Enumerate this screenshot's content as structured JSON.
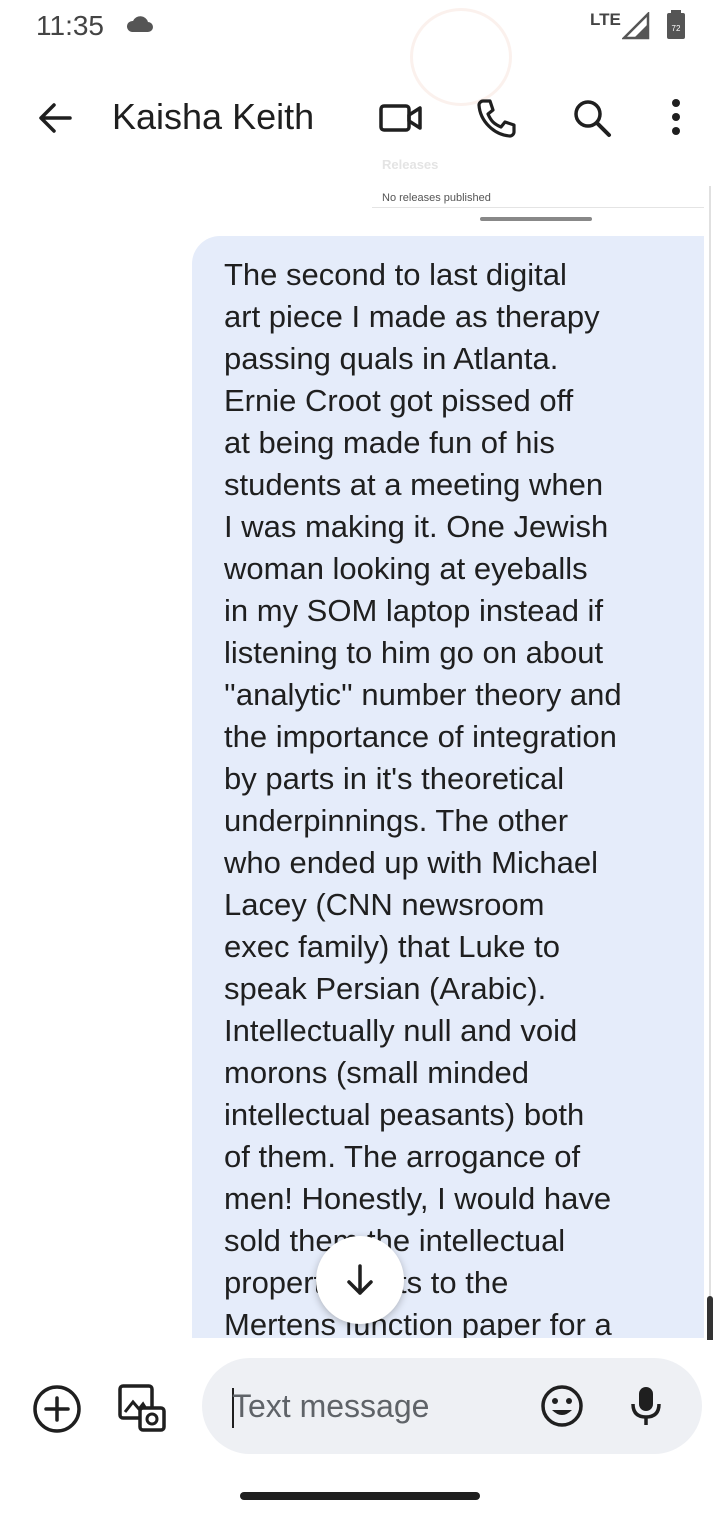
{
  "status_bar": {
    "time": "11:35",
    "network": "LTE",
    "battery_level": "72"
  },
  "header": {
    "contact_name": "Kaisha Keith",
    "icons": [
      "back-icon",
      "video-call-icon",
      "phone-icon",
      "search-icon",
      "more-options-icon"
    ]
  },
  "background_overlay": {
    "section_title": "Releases",
    "releases_text": "No releases published"
  },
  "conversation": {
    "message_text": "The second to last digital\nart piece I made as therapy\npassing quals in Atlanta.\nErnie Croot got pissed off\nat being made fun of his\nstudents at a meeting when\nI was making it. One Jewish\nwoman looking at eyeballs\nin my SOM laptop instead if\nlistening to him go on about\n''analytic'' number theory and\nthe importance of integration\nby parts in it's theoretical\nunderpinnings. The other\nwho ended up with Michael\nLacey (CNN newsroom\nexec family) that Luke to\nspeak Persian (Arabic).\nIntellectually null and void\nmorons (small minded\nintellectual peasants) both\nof them. The arrogance of\nmen! Honestly, I would have\nsold them the intellectual\nproperty rights to the\nMertens function paper for a"
  },
  "compose": {
    "placeholder": "Text message"
  },
  "colors": {
    "bubble_background": "#e5ecfa",
    "input_background": "#eef0f4",
    "text_primary": "#1f1f1f"
  }
}
